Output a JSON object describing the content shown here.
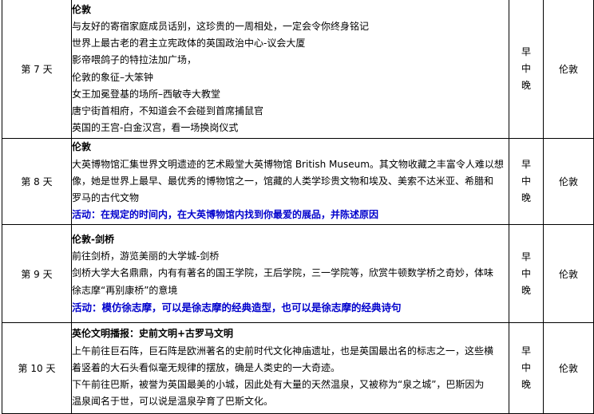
{
  "days": [
    {
      "day": "第 7 天",
      "title": "伦敦",
      "lines": [
        "与友好的寄宿家庭成员话别，这珍贵的一周相处，一定会令你终身铭记",
        "世界上最古老的君主立宪政体的英国政治中心-议会大厦",
        "影帝喂鸽子的特拉法加广场，",
        "伦敦的象征–大笨钟",
        "女王加冕登基的场所–西敏寺大教堂",
        "唐宁街首相府，不知道会不会碰到首席捕鼠官",
        "英国的王宫-白金汉宫，看一场换岗仪式"
      ],
      "activity": "",
      "meals": [
        "早",
        "中",
        "晚"
      ],
      "hotel": "伦敦"
    },
    {
      "day": "第 8 天",
      "title": "伦敦",
      "lines": [
        "大英博物馆汇集世界文明遗迹的艺术殿堂大英博物馆 British Museum。其文物收藏之丰富令人难以想",
        "像，她是世界上最早、最优秀的博物馆之一，馆藏的人类学珍贵文物和埃及、美索不达米亚、希腊和",
        "罗马的古代文物"
      ],
      "activity": "活动：在规定的时间内，在大英博物馆内找到你最爱的展品，并陈述原因",
      "meals": [
        "早",
        "中",
        "晚"
      ],
      "hotel": "伦敦"
    },
    {
      "day": "第 9 天",
      "title": "伦敦-剑桥",
      "lines": [
        "前往剑桥，游览美丽的大学城-剑桥",
        "剑桥大学大名鼎鼎，内有有著名的国王学院，王后学院，三一学院等，欣赏牛顿数学桥之奇妙，体味",
        "徐志摩“再别康桥”的意境"
      ],
      "activity": "活动：模仿徐志摩，可以是徐志摩的经典造型，也可以是徐志摩的经典诗句",
      "meals": [
        "早",
        "中",
        "晚"
      ],
      "hotel": "伦敦"
    },
    {
      "day": "第 10 天",
      "title": "英伦文明播报：史前文明+古罗马文明",
      "lines": [
        "上午前往巨石阵，巨石阵是欧洲著名的史前时代文化神庙遗址，也是英国最出名的标志之一，这些横",
        "着竖着的大石头看似毫无规律的摆放，确是人类史的一大奇迹。",
        "下午前往巴斯，被誉为英国最美的小城，因此处有大量的天然温泉，又被称为“泉之城”，巴斯因为",
        "温泉闻名于世，可以说是温泉孕育了巴斯文化。"
      ],
      "activity": "",
      "meals": [
        "早",
        "中",
        "晚"
      ],
      "hotel": "伦敦"
    }
  ]
}
